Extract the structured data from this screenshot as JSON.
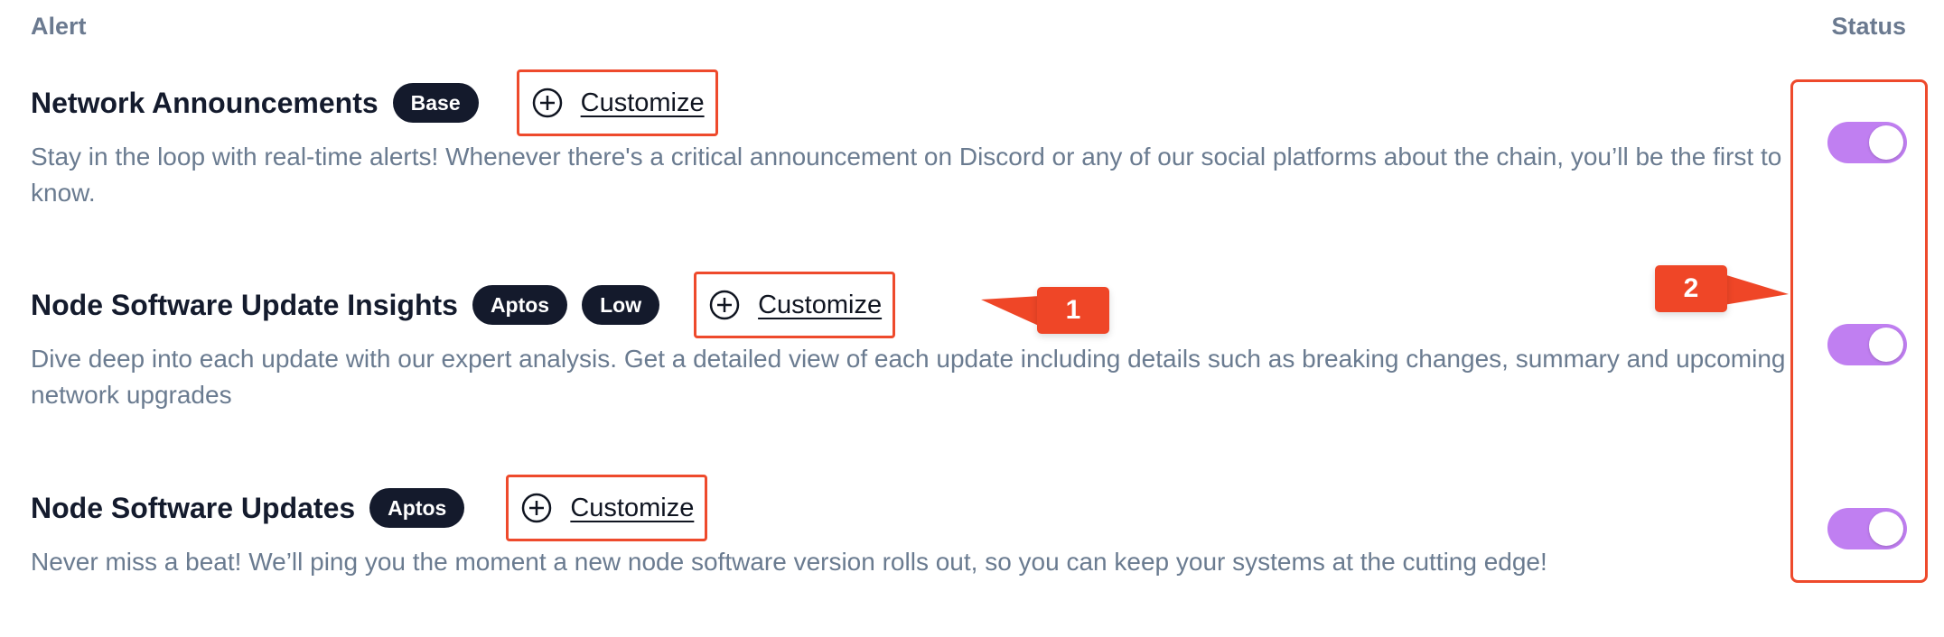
{
  "header": {
    "alert_label": "Alert",
    "status_label": "Status"
  },
  "alerts": [
    {
      "title": "Network Announcements",
      "tags": [
        "Base"
      ],
      "customize_label": "Customize",
      "description": "Stay in the loop with real-time alerts! Whenever there's a critical announcement on Discord or any of our social platforms about the chain, you’ll be the first to know.",
      "enabled": true
    },
    {
      "title": "Node Software Update Insights",
      "tags": [
        "Aptos",
        "Low"
      ],
      "customize_label": "Customize",
      "description": "Dive deep into each update with our expert analysis. Get a detailed view of each update including details such as breaking changes, summary and upcoming network upgrades",
      "enabled": true
    },
    {
      "title": "Node Software Updates",
      "tags": [
        "Aptos"
      ],
      "customize_label": "Customize",
      "description": "Never miss a beat! We’ll ping you the moment a new node software version rolls out, so you can keep your systems at the cutting edge!",
      "enabled": true
    }
  ],
  "annotations": {
    "callout_1": "1",
    "callout_2": "2"
  },
  "colors": {
    "annotation": "#ee4a2c",
    "toggle_on": "#c07ff1",
    "tag_bg": "#141a2c",
    "description_text": "#6a7b90"
  },
  "icons": {
    "customize": "plus-circle-icon",
    "toggle": "toggle-switch"
  }
}
